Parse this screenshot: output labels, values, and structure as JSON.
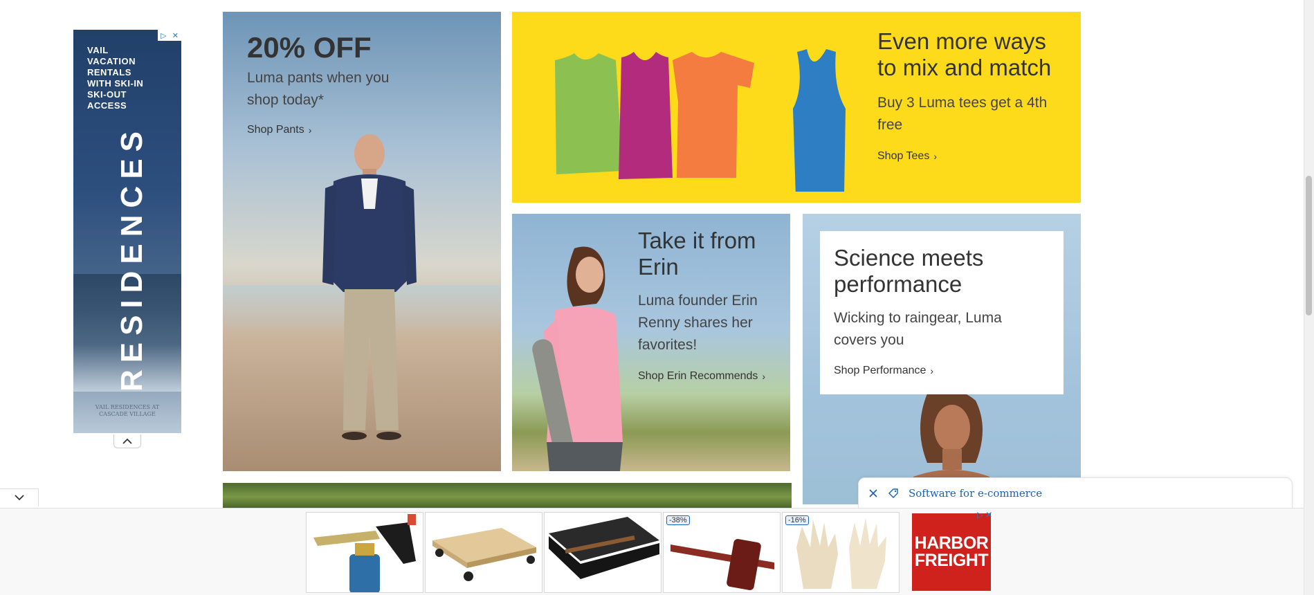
{
  "side_ad": {
    "headline": "VAIL VACATION RENTALS WITH SKI-IN SKI-OUT ACCESS",
    "brand": "RESIDENCES",
    "footer": "VAIL RESIDENCES AT CASCADE VILLAGE",
    "adchoice": "▷",
    "close": "✕"
  },
  "pants_block": {
    "title": "20% OFF",
    "subtitle": "Luma pants when you shop today*",
    "link": "Shop Pants"
  },
  "tees_block": {
    "title": "Even more ways to mix and match",
    "subtitle": "Buy 3 Luma tees get a 4th free",
    "link": "Shop Tees",
    "colors": [
      "#8cc152",
      "#b32b7d",
      "#f47c40",
      "#2e7ec4"
    ]
  },
  "erin_block": {
    "title": "Take it from Erin",
    "subtitle": "Luma founder Erin Renny shares her favorites!",
    "link": "Shop Erin Recommends"
  },
  "performance_block": {
    "title": "Science meets performance",
    "subtitle": "Wicking to raingear, Luma covers you",
    "link": "Shop Performance"
  },
  "search_chip": {
    "text": "Software for e-commerce"
  },
  "bottom_ad": {
    "products": [
      {
        "name": "torch",
        "badge": ""
      },
      {
        "name": "dolly",
        "badge": ""
      },
      {
        "name": "case",
        "badge": ""
      },
      {
        "name": "marking-gauge",
        "badge": "-38%"
      },
      {
        "name": "gloves",
        "badge": "-16%"
      }
    ],
    "brand_line1": "HARBOR",
    "brand_line2": "FREIGHT",
    "adchoice": "▷",
    "close": "✕"
  }
}
